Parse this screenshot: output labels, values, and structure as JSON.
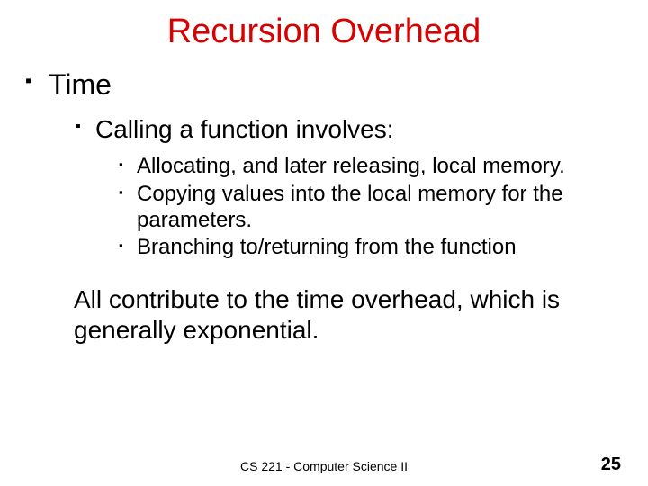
{
  "title": "Recursion Overhead",
  "bullets": {
    "l1_time": "Time",
    "l2_calling": "Calling a function involves:",
    "l3_alloc": "Allocating, and later releasing, local memory.",
    "l3_copy": "Copying values into the local memory for the parameters.",
    "l3_branch": "Branching to/returning from the function"
  },
  "summary": "All contribute to the time overhead, which is generally exponential.",
  "footer": {
    "course": "CS 221 - Computer Science II",
    "page": "25"
  }
}
